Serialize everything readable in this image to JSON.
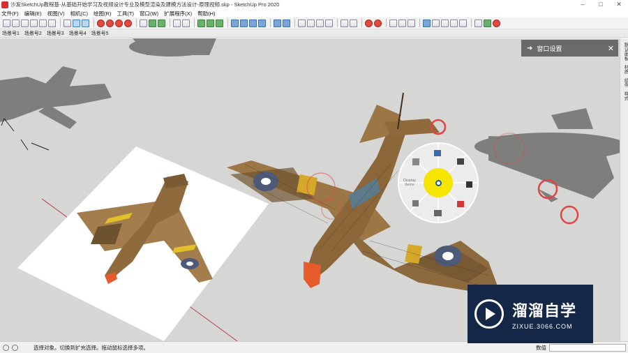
{
  "window": {
    "title": "沙发SketchUp教程基-从基础开始学习及视频设计专业及模型渲染及建模方法设计-原理视频.skp - SketchUp Pro 2020",
    "minimize": "–",
    "maximize": "□",
    "close": "✕"
  },
  "menu": [
    "文件(F)",
    "编辑(E)",
    "视图(V)",
    "相机(C)",
    "绘图(R)",
    "工具(T)",
    "窗口(W)",
    "扩展程序(X)",
    "帮助(H)"
  ],
  "scenes": [
    "场景号1",
    "场景号2",
    "场景号3",
    "场景号4",
    "场景号5"
  ],
  "tray": {
    "arrow": "➜",
    "title": "窗口设置",
    "close": "✕"
  },
  "side_panel": [
    "默认面板",
    "材质",
    "组件",
    "样式"
  ],
  "radial_menu": {
    "center_icon": "target-icon",
    "label": "Display Items"
  },
  "status": {
    "message": "选择对象。切换到扩充选择。拖动鼠标选择多项。",
    "value_label": "数值",
    "value": ""
  },
  "watermark": {
    "brand": "溜溜自学",
    "url": "ZIXUE.3066.COM"
  },
  "colors": {
    "sky": "#d6d6d4",
    "shadow": "#6f6f6f",
    "tray": "#6a6a6a",
    "radial_center": "#f5e500",
    "marker": "#e04545",
    "watermark": "#152746"
  }
}
